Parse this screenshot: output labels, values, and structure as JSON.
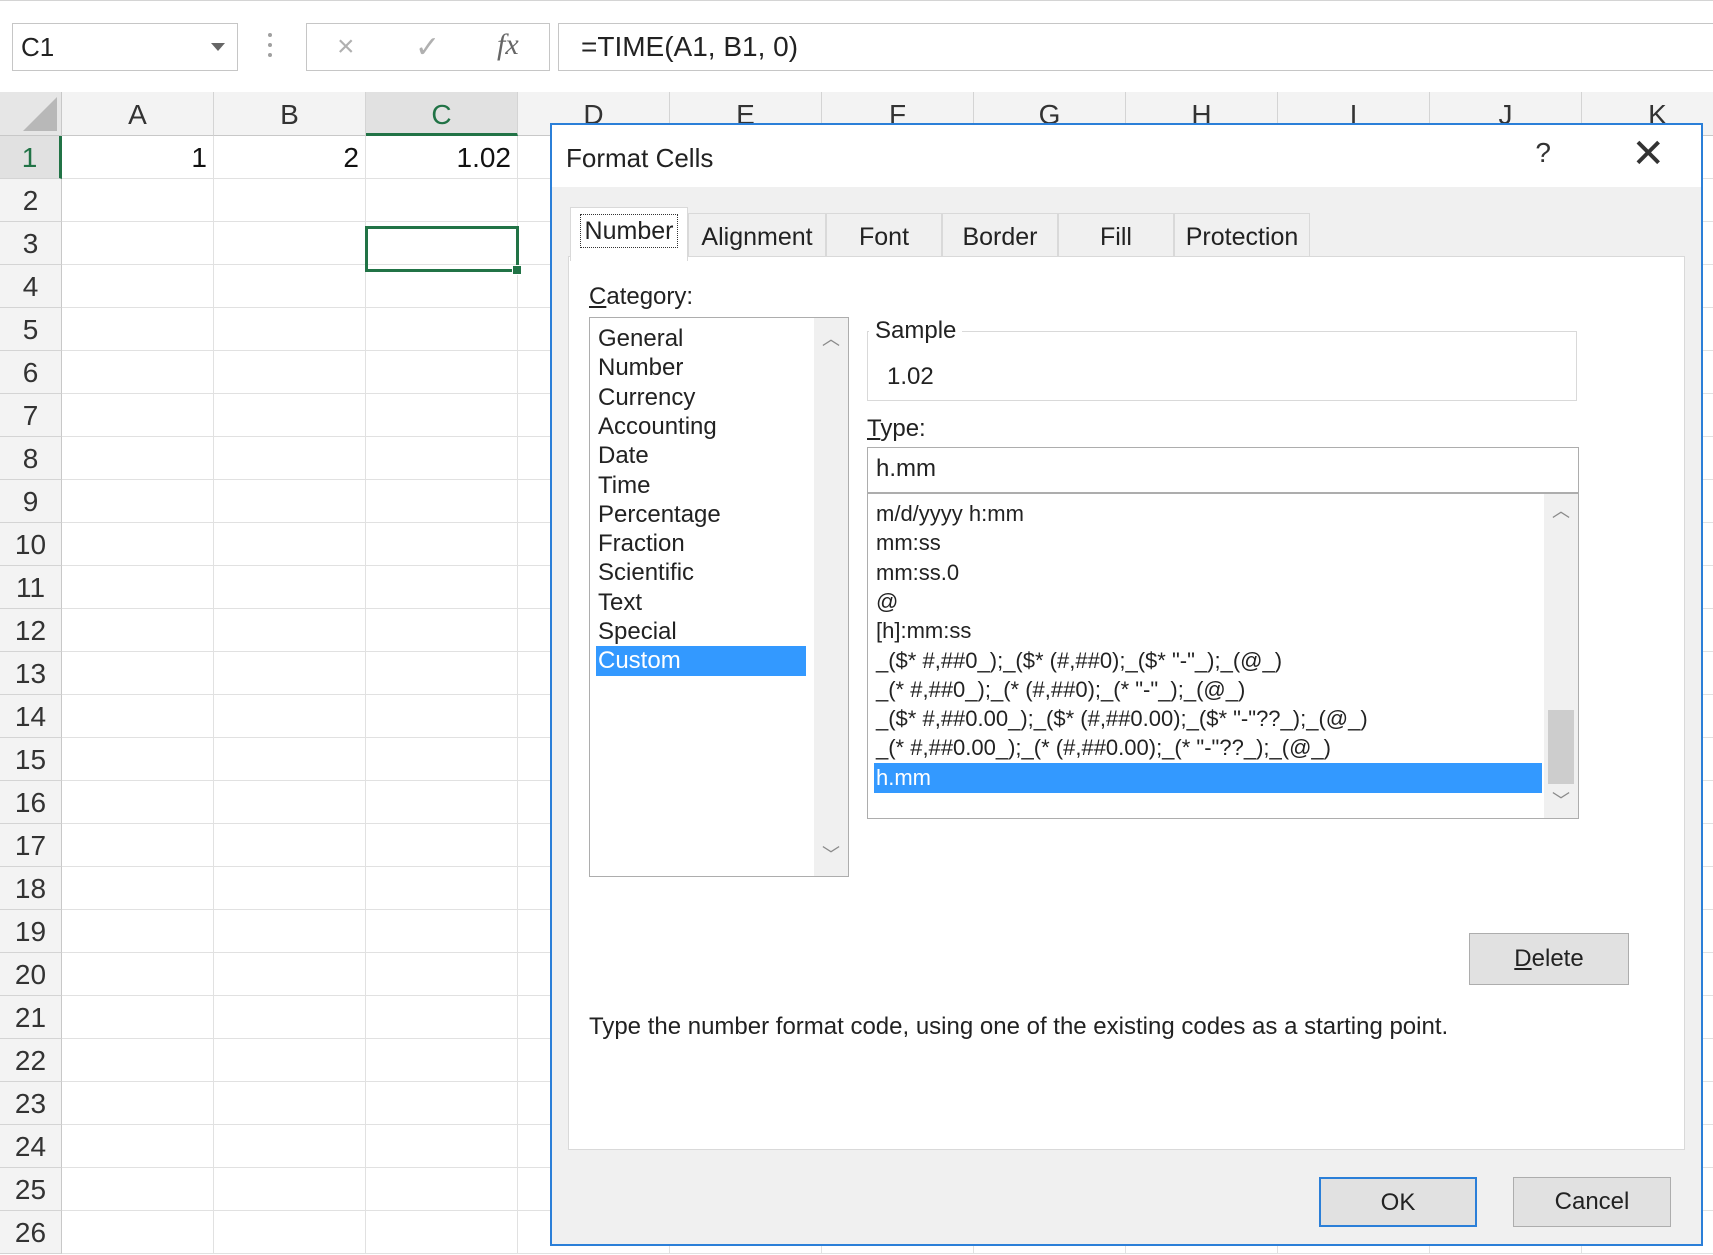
{
  "formula_bar": {
    "name_box": "C1",
    "cancel_icon": "×",
    "enter_icon": "✓",
    "function_icon": "fx",
    "formula": "=TIME(A1, B1, 0)"
  },
  "sheet": {
    "columns": [
      "A",
      "B",
      "C",
      "D",
      "E",
      "F",
      "G",
      "H",
      "I",
      "J",
      "K"
    ],
    "selected_column": "C",
    "rows": [
      "1",
      "2",
      "3",
      "4",
      "5",
      "6",
      "7",
      "8",
      "9",
      "10",
      "11",
      "12",
      "13",
      "14",
      "15",
      "16",
      "17",
      "18",
      "19",
      "20",
      "21",
      "22",
      "23",
      "24",
      "25",
      "26"
    ],
    "selected_row": "1",
    "cells": {
      "A1": "1",
      "B1": "2",
      "C1": "1.02"
    },
    "accent_color": "#217346"
  },
  "dialog": {
    "title": "Format Cells",
    "help_label": "?",
    "close_label": "✕",
    "tabs": [
      "Number",
      "Alignment",
      "Font",
      "Border",
      "Fill",
      "Protection"
    ],
    "active_tab": "Number",
    "category_label": "Category:",
    "categories": [
      "General",
      "Number",
      "Currency",
      "Accounting",
      "Date",
      "Time",
      "Percentage",
      "Fraction",
      "Scientific",
      "Text",
      "Special",
      "Custom"
    ],
    "selected_category": "Custom",
    "sample_label": "Sample",
    "sample_value": "1.02",
    "type_label": "Type:",
    "type_value": "h.mm",
    "type_list": [
      "m/d/yyyy h:mm",
      "mm:ss",
      "mm:ss.0",
      "@",
      "[h]:mm:ss",
      "_($* #,##0_);_($* (#,##0);_($* \"-\"_);_(@_)",
      "_(* #,##0_);_(* (#,##0);_(* \"-\"_);_(@_)",
      "_($* #,##0.00_);_($* (#,##0.00);_($* \"-\"??_);_(@_)",
      "_(* #,##0.00_);_(* (#,##0.00);_(* \"-\"??_);_(@_)",
      "h.mm"
    ],
    "selected_type": "h.mm",
    "delete_label": "Delete",
    "hint": "Type the number format code, using one of the existing codes as a starting point.",
    "ok_label": "OK",
    "cancel_label": "Cancel",
    "selection_color": "#3399ff",
    "border_color": "#2b7fd8"
  }
}
